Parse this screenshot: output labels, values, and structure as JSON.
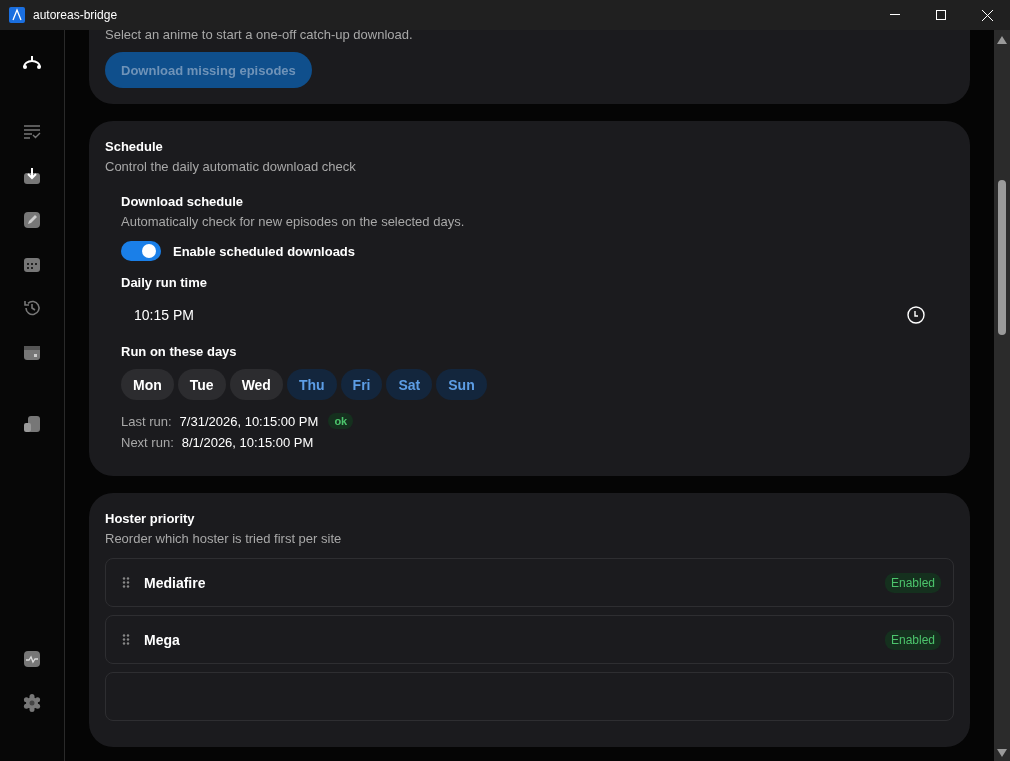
{
  "window": {
    "title": "autoreas-bridge"
  },
  "sidebar": {
    "items": [
      {
        "selected": true
      },
      {
        "selected": false
      },
      {
        "selected": false
      },
      {
        "selected": false
      },
      {
        "selected": false
      },
      {
        "selected": false
      },
      {
        "selected": false
      },
      {
        "selected": false
      }
    ],
    "bottom_items": [
      {
        "selected": false
      },
      {
        "selected": false
      }
    ]
  },
  "catchup": {
    "description": "Select an anime to start a one-off catch-up download.",
    "button": {
      "label": "Download missing episodes",
      "disabled": true
    }
  },
  "schedule": {
    "title": "Schedule",
    "subtitle": "Control the daily automatic download check",
    "section_title": "Download schedule",
    "section_subtitle": "Automatically check for new episodes on the selected days.",
    "toggle": {
      "label": "Enable scheduled downloads",
      "on": true
    },
    "time_label": "Daily run time",
    "time_value": "10:15 PM",
    "days_label": "Run on these days",
    "days": [
      {
        "label": "Mon",
        "selected": false
      },
      {
        "label": "Tue",
        "selected": false
      },
      {
        "label": "Wed",
        "selected": false
      },
      {
        "label": "Thu",
        "selected": true
      },
      {
        "label": "Fri",
        "selected": true
      },
      {
        "label": "Sat",
        "selected": true
      },
      {
        "label": "Sun",
        "selected": true
      }
    ],
    "last_run_label": "Last run:",
    "last_run": "7/31/2026, 10:15:00 PM",
    "last_status": "ok",
    "next_run_label": "Next run:",
    "next_run": "8/1/2026, 10:15:00 PM"
  },
  "hoster_priority": {
    "title": "Hoster priority",
    "subtitle": "Reorder which hoster is tried first per site",
    "hosters": [
      {
        "name": "Mediafire",
        "status": "Enabled"
      },
      {
        "name": "Mega",
        "status": "Enabled"
      },
      {
        "kind": "cut"
      }
    ]
  }
}
